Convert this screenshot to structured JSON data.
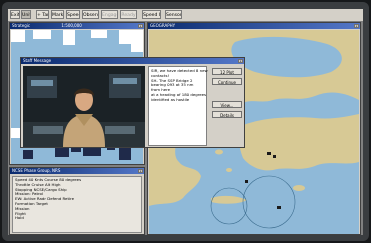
{
  "toolbar": {
    "buttons": [
      {
        "label": "Exit",
        "disabled": false,
        "active": false
      },
      {
        "label": "Units",
        "disabled": false,
        "active": true
      },
      {
        "label": "+ Tar",
        "disabled": false,
        "active": false
      },
      {
        "label": "Mark",
        "disabled": false,
        "active": false
      },
      {
        "label": "Speed",
        "disabled": false,
        "active": false
      },
      {
        "label": "Observe",
        "disabled": false,
        "active": false
      },
      {
        "label": "Engage",
        "disabled": true,
        "active": false
      },
      {
        "label": "Ready",
        "disabled": true,
        "active": false
      },
      {
        "label": "Speed In",
        "disabled": false,
        "active": false
      },
      {
        "label": "Sensors",
        "disabled": false,
        "active": false
      }
    ]
  },
  "strategic_window": {
    "title": "Strategic",
    "scale": "1:500,000"
  },
  "map_window": {
    "title": "GEOGRAPHY"
  },
  "staff_message": {
    "title": "Staff Message",
    "message_lines": [
      "SIR, we have detected 8 new",
      "contacts!",
      "",
      "SH- The SSP Bridge 2",
      "bearing 093 at 35 nm",
      "from here",
      "at a heading of 180 degrees",
      "identified as hostile"
    ],
    "buttons": {
      "cancel": "12 Plot",
      "continue": "Continue",
      "view": "View...",
      "details": "Details"
    }
  },
  "unit_panel": {
    "title": "NCSE Phase Group, NRS",
    "lines": [
      "Speed  40 Knts    Course  80 degrees",
      "Throttle  Cruise     Alt  High",
      "Stopping  NCSE/Cargo Ship",
      "Mission: Patrol",
      "EW: Active Radr   Defend    Retire",
      "Formation   Target",
      "Mission",
      "Flight",
      "Hold"
    ]
  },
  "colors": {
    "sea": "#8fb9d8",
    "land": "#d7c995",
    "titlebar": "#0a2a6e",
    "window_face": "#d4d0c8"
  }
}
